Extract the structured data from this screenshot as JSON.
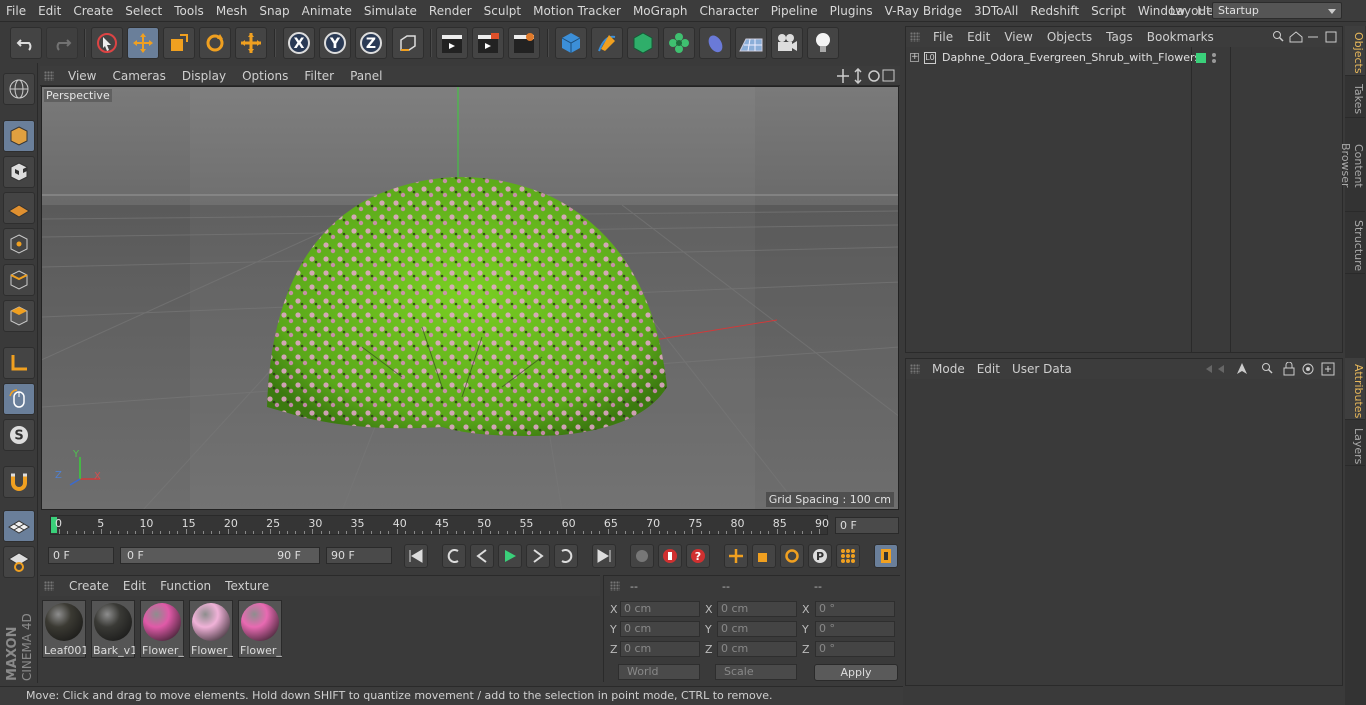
{
  "menubar": {
    "items": [
      "File",
      "Edit",
      "Create",
      "Select",
      "Tools",
      "Mesh",
      "Snap",
      "Animate",
      "Simulate",
      "Render",
      "Sculpt",
      "Motion Tracker",
      "MoGraph",
      "Character",
      "Pipeline",
      "Plugins",
      "V-Ray Bridge",
      "3DToAll",
      "Redshift",
      "Script",
      "Window",
      "Help"
    ],
    "layout_label": "Layout:",
    "layout_value": "Startup"
  },
  "viewport": {
    "menu": [
      "View",
      "Cameras",
      "Display",
      "Options",
      "Filter",
      "Panel"
    ],
    "label": "Perspective",
    "grid_spacing": "Grid Spacing : 100 cm"
  },
  "timeline": {
    "ticks": [
      "0",
      "5",
      "10",
      "15",
      "20",
      "25",
      "30",
      "35",
      "40",
      "45",
      "50",
      "55",
      "60",
      "65",
      "70",
      "75",
      "80",
      "85",
      "90"
    ],
    "current_frame": "0 F"
  },
  "anim": {
    "start_frame": "0 F",
    "range_start": "0 F",
    "range_end": "90 F",
    "end_frame": "90 F"
  },
  "material_panel": {
    "menu": [
      "Create",
      "Edit",
      "Function",
      "Texture"
    ],
    "materials": [
      {
        "name": "Leaf001",
        "color": "#3b3a33"
      },
      {
        "name": "Bark_v1",
        "color": "#3a3a36"
      },
      {
        "name": "Flower_",
        "color": "#e05aa8"
      },
      {
        "name": "Flower_",
        "color": "#f0b2d8"
      },
      {
        "name": "Flower_",
        "color": "#e86ab2"
      }
    ]
  },
  "coords": {
    "headers": [
      "--",
      "--",
      "--"
    ],
    "rows": [
      {
        "a": "X",
        "v1": "0 cm",
        "b": "X",
        "v2": "0 cm",
        "c": "X",
        "v3": "0 °"
      },
      {
        "a": "Y",
        "v1": "0 cm",
        "b": "Y",
        "v2": "0 cm",
        "c": "Y",
        "v3": "0 °"
      },
      {
        "a": "Z",
        "v1": "0 cm",
        "b": "Z",
        "v2": "0 cm",
        "c": "Z",
        "v3": "0 °"
      }
    ],
    "mode_select": "World",
    "scale_select": "Scale",
    "apply": "Apply"
  },
  "status": "Move: Click and drag to move elements. Hold down SHIFT to quantize movement / add to the selection in point mode, CTRL to remove.",
  "objects_panel": {
    "menu": [
      "File",
      "Edit",
      "View",
      "Objects",
      "Tags",
      "Bookmarks"
    ],
    "object_name": "Daphne_Odora_Evergreen_Shrub_with_Flowers"
  },
  "attributes_panel": {
    "menu": [
      "Mode",
      "Edit",
      "User Data"
    ]
  },
  "right_tabs": [
    "Objects",
    "Takes",
    "Content Browser",
    "Structure",
    "Attributes",
    "Layers"
  ],
  "brand": {
    "line1": "MAXON",
    "line2": "CINEMA 4D"
  }
}
